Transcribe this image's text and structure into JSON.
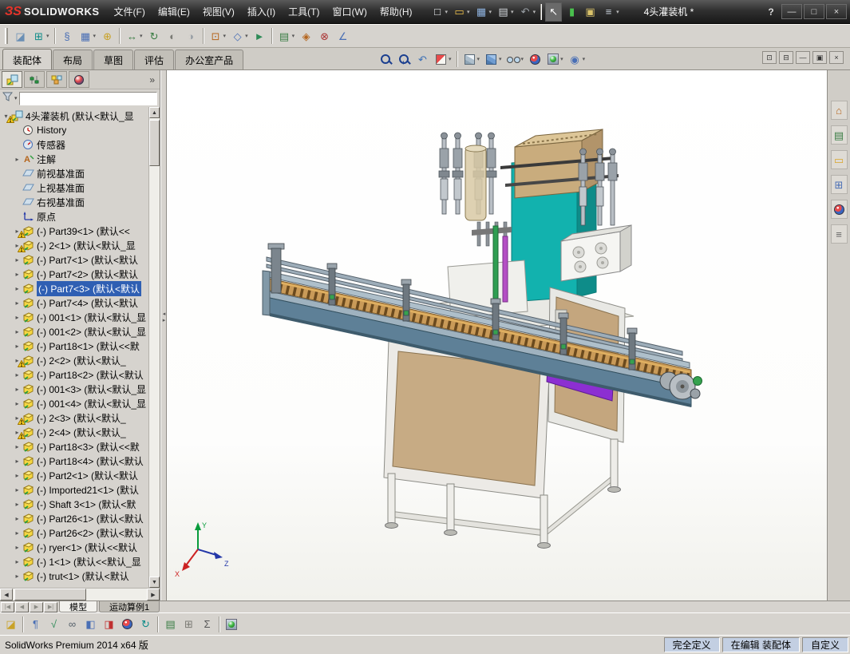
{
  "titlebar": {
    "logo_mark": "ЗS",
    "logo_word": "SOLIDWORKS",
    "doc_title": "4头灌装机 *",
    "help_label": "?"
  },
  "menus": [
    "文件(F)",
    "编辑(E)",
    "视图(V)",
    "插入(I)",
    "工具(T)",
    "窗口(W)",
    "帮助(H)"
  ],
  "standard_toolbar": [
    {
      "name": "new-document",
      "glyph": "□",
      "fg": "#f2f4f8",
      "dd": true
    },
    {
      "name": "open-document",
      "glyph": "▭",
      "fg": "#f0c24a",
      "dd": true
    },
    {
      "name": "save-document",
      "glyph": "▦",
      "fg": "#8fb3e0",
      "dd": true
    },
    {
      "name": "print-document",
      "glyph": "▤",
      "fg": "#d6dade",
      "dd": true
    },
    {
      "name": "undo",
      "glyph": "↶",
      "fg": "#9aa0a6",
      "dd": true
    },
    {
      "sep": true
    },
    {
      "name": "select",
      "glyph": "↖",
      "fg": "#ffffff",
      "pressed": true
    },
    {
      "name": "rebuild",
      "glyph": "▮",
      "fg": "#49c04d"
    },
    {
      "name": "file-properties",
      "glyph": "▣",
      "fg": "#d9c26a"
    },
    {
      "name": "options",
      "glyph": "≡",
      "fg": "#c4cdd6",
      "dd": true
    }
  ],
  "window_buttons": [
    {
      "name": "minimize-app",
      "glyph": "—"
    },
    {
      "name": "maximize-app",
      "glyph": "□"
    },
    {
      "name": "close-app",
      "glyph": "×"
    }
  ],
  "assembly_toolbar": [
    {
      "name": "edit-component",
      "glyph": "◪",
      "fg": "#6a8fb5"
    },
    {
      "name": "insert-components",
      "glyph": "⊞",
      "fg": "#0e8c89",
      "dd": true
    },
    {
      "sep": true
    },
    {
      "name": "mate",
      "glyph": "§",
      "fg": "#4a6fb5"
    },
    {
      "name": "component-pattern",
      "glyph": "▦",
      "fg": "#4a6fb5",
      "dd": true
    },
    {
      "name": "smart-fasteners",
      "glyph": "⊕",
      "fg": "#c9a227"
    },
    {
      "sep": true
    },
    {
      "name": "move-component",
      "glyph": "↔",
      "fg": "#3a7d44",
      "dd": true
    },
    {
      "name": "rotate-component",
      "glyph": "↻",
      "fg": "#3a7d44"
    },
    {
      "name": "show-hidden-components",
      "glyph": "◐",
      "fg": "#7a7a74"
    },
    {
      "name": "change-transparency",
      "glyph": "◑",
      "fg": "#9aa0a6"
    },
    {
      "sep": true
    },
    {
      "name": "assembly-features",
      "glyph": "⊡",
      "fg": "#b5651d",
      "dd": true
    },
    {
      "name": "reference-geometry",
      "glyph": "◇",
      "fg": "#4a6fb5",
      "dd": true
    },
    {
      "name": "new-motion-study",
      "glyph": "►",
      "fg": "#2e8b57"
    },
    {
      "sep": true
    },
    {
      "name": "bill-of-materials",
      "glyph": "▤",
      "fg": "#3a7d44",
      "dd": true
    },
    {
      "name": "exploded-view",
      "glyph": "◈",
      "fg": "#b5651d"
    },
    {
      "name": "interference-detection",
      "glyph": "⊗",
      "fg": "#aa3333"
    },
    {
      "name": "measure",
      "glyph": "∠",
      "fg": "#4a6fb5"
    }
  ],
  "command_tabs": [
    {
      "label": "装配体",
      "active": true
    },
    {
      "label": "布局",
      "active": false
    },
    {
      "label": "草图",
      "active": false
    },
    {
      "label": "评估",
      "active": false
    },
    {
      "label": "办公室产品",
      "active": false
    }
  ],
  "headsup_toolbar": [
    {
      "name": "zoom-to-fit",
      "cls": "mag"
    },
    {
      "name": "zoom-to-area",
      "cls": "mag",
      "glyph": "+"
    },
    {
      "name": "previous-view",
      "glyph": "↶",
      "fg": "#3a6fb5"
    },
    {
      "name": "section-view",
      "cls": "half",
      "dd": true
    },
    {
      "sep": true
    },
    {
      "name": "view-orientation",
      "cls": "cube",
      "dd": true
    },
    {
      "name": "display-style",
      "cls": "cubesh",
      "dd": true
    },
    {
      "name": "hide-show-items",
      "cls": "glasses",
      "dd": true
    },
    {
      "name": "edit-appearance",
      "cls": "ball"
    },
    {
      "name": "apply-scene",
      "cls": "scene",
      "dd": true
    },
    {
      "name": "view-settings",
      "glyph": "◉",
      "fg": "#4a6fb5",
      "dd": true
    }
  ],
  "doc_window_buttons": [
    {
      "name": "tile-window",
      "glyph": "⊡"
    },
    {
      "name": "cascade-window",
      "glyph": "⊟"
    },
    {
      "name": "minimize-document",
      "glyph": "—"
    },
    {
      "name": "restore-document",
      "glyph": "▣"
    },
    {
      "name": "close-document",
      "glyph": "×"
    }
  ],
  "panel_tabs": [
    {
      "name": "featuremanager-tab",
      "icon": "assembly",
      "active": true
    },
    {
      "name": "propertymanager-tab",
      "icon": "pm",
      "active": false
    },
    {
      "name": "configurationmanager-tab",
      "icon": "config",
      "active": false
    },
    {
      "name": "displaymanager-tab",
      "icon": "ballsvg",
      "active": false
    }
  ],
  "panel_expand": "»",
  "tree": {
    "items": [
      {
        "icon": "assembly",
        "label": "4头灌装机 (默认<默认_显",
        "warn": true,
        "arrow": "▾",
        "root": true
      },
      {
        "icon": "history",
        "label": "History",
        "arrow": ""
      },
      {
        "icon": "sensors",
        "label": "传感器",
        "arrow": ""
      },
      {
        "icon": "annotations",
        "label": "注解",
        "arrow": "▸"
      },
      {
        "icon": "plane",
        "label": "前视基准面",
        "arrow": ""
      },
      {
        "icon": "plane",
        "label": "上视基准面",
        "arrow": ""
      },
      {
        "icon": "plane",
        "label": "右视基准面",
        "arrow": ""
      },
      {
        "icon": "origin",
        "label": "原点",
        "arrow": ""
      },
      {
        "icon": "part",
        "label": "(-) Part39<1> (默认<<",
        "warn": true,
        "arrow": "▸"
      },
      {
        "icon": "part",
        "label": "(-) 2<1> (默认<默认_显",
        "warn": true,
        "arrow": "▸"
      },
      {
        "icon": "part",
        "label": "(-) Part7<1> (默认<默认",
        "arrow": "▸"
      },
      {
        "icon": "part",
        "label": "(-) Part7<2> (默认<默认",
        "arrow": "▸"
      },
      {
        "icon": "part",
        "label": "(-) Part7<3> (默认<默认",
        "arrow": "▸",
        "selected": true
      },
      {
        "icon": "part",
        "label": "(-) Part7<4> (默认<默认",
        "arrow": "▸"
      },
      {
        "icon": "part",
        "label": "(-) 001<1> (默认<默认_显",
        "arrow": "▸"
      },
      {
        "icon": "part",
        "label": "(-) 001<2> (默认<默认_显",
        "arrow": "▸"
      },
      {
        "icon": "part",
        "label": "(-) Part18<1> (默认<<默",
        "arrow": "▸"
      },
      {
        "icon": "part",
        "label": "(-) 2<2> (默认<默认_",
        "warn": true,
        "arrow": "▸"
      },
      {
        "icon": "part",
        "label": "(-) Part18<2> (默认<默认",
        "arrow": "▸"
      },
      {
        "icon": "part",
        "label": "(-) 001<3> (默认<默认_显",
        "arrow": "▸"
      },
      {
        "icon": "part",
        "label": "(-) 001<4> (默认<默认_显",
        "arrow": "▸"
      },
      {
        "icon": "part",
        "label": "(-) 2<3> (默认<默认_",
        "warn": true,
        "arrow": "▸"
      },
      {
        "icon": "part",
        "label": "(-) 2<4> (默认<默认_",
        "warn": true,
        "arrow": "▸"
      },
      {
        "icon": "part",
        "label": "(-) Part18<3> (默认<<默",
        "arrow": "▸"
      },
      {
        "icon": "part",
        "label": "(-) Part18<4> (默认<默认",
        "arrow": "▸"
      },
      {
        "icon": "part",
        "label": "(-) Part2<1> (默认<默认",
        "arrow": "▸"
      },
      {
        "icon": "part",
        "label": "(-) Imported21<1> (默认",
        "arrow": "▸"
      },
      {
        "icon": "part",
        "label": "(-) Shaft 3<1> (默认<默",
        "arrow": "▸"
      },
      {
        "icon": "part",
        "label": "(-) Part26<1> (默认<默认",
        "arrow": "▸"
      },
      {
        "icon": "part",
        "label": "(-) Part26<2> (默认<默认",
        "arrow": "▸"
      },
      {
        "icon": "part",
        "label": "(-) ryer<1> (默认<<默认",
        "arrow": "▸"
      },
      {
        "icon": "part",
        "label": "(-) 1<1> (默认<<默认_显",
        "arrow": "▸"
      },
      {
        "icon": "part",
        "label": "(-) trut<1> (默认<默认",
        "arrow": "▸"
      }
    ]
  },
  "taskpane": [
    {
      "name": "solidworks-resources",
      "glyph": "⌂",
      "fg": "#b5651d"
    },
    {
      "name": "design-library",
      "glyph": "▤",
      "fg": "#3a7d44"
    },
    {
      "name": "file-explorer",
      "glyph": "▭",
      "fg": "#d9a62e"
    },
    {
      "name": "view-palette",
      "glyph": "⊞",
      "fg": "#4a6fb5"
    },
    {
      "name": "appearances-scenes",
      "cls": "ball"
    },
    {
      "name": "custom-properties",
      "glyph": "≡",
      "fg": "#666666"
    }
  ],
  "bottom_tabs": [
    {
      "label": "模型",
      "active": true
    },
    {
      "label": "运动算例1",
      "active": false
    }
  ],
  "nav_buttons": [
    {
      "name": "first-tab",
      "glyph": "|◀"
    },
    {
      "name": "previous-tab",
      "glyph": "◀"
    },
    {
      "name": "next-tab",
      "glyph": "▶"
    },
    {
      "name": "last-tab",
      "glyph": "▶|"
    }
  ],
  "bottom_toolbar": [
    {
      "name": "edit-component",
      "glyph": "◪",
      "fg": "#c9a227"
    },
    {
      "sep": true
    },
    {
      "name": "note",
      "glyph": "¶",
      "fg": "#4a6fb5"
    },
    {
      "name": "spell-checker",
      "glyph": "√",
      "fg": "#2e8b57"
    },
    {
      "name": "hide-show-items",
      "glyph": "∞",
      "fg": "#55606a"
    },
    {
      "name": "display-style",
      "glyph": "◧",
      "fg": "#4a6fb5"
    },
    {
      "name": "section-view",
      "glyph": "◨",
      "fg": "#c03030"
    },
    {
      "name": "edit-appearance",
      "cls": "ball"
    },
    {
      "name": "rotate-view",
      "glyph": "↻",
      "fg": "#0e8c89"
    },
    {
      "sep": true
    },
    {
      "name": "bill-of-materials",
      "glyph": "▤",
      "fg": "#3a7d44"
    },
    {
      "name": "design-table",
      "glyph": "⊞",
      "fg": "#7a7a74"
    },
    {
      "name": "equations",
      "glyph": "Σ",
      "fg": "#555555"
    },
    {
      "sep": true
    },
    {
      "name": "apply-scene",
      "cls": "scene"
    }
  ],
  "statusbar": {
    "left": "SolidWorks Premium 2014 x64 版",
    "cells": [
      "完全定义",
      "在编辑 装配体",
      "自定义"
    ]
  },
  "viewport": {
    "triad": {
      "x": "X",
      "y": "Y",
      "z": "Z"
    }
  },
  "colors": {
    "selection": "#2f5fb3",
    "teal_machine": "#12b2ae",
    "tan_panel": "#c7ab84",
    "conveyor_blue": "#5e8097",
    "chain_tan": "#c99a58",
    "purple_part": "#8c2fd2"
  }
}
